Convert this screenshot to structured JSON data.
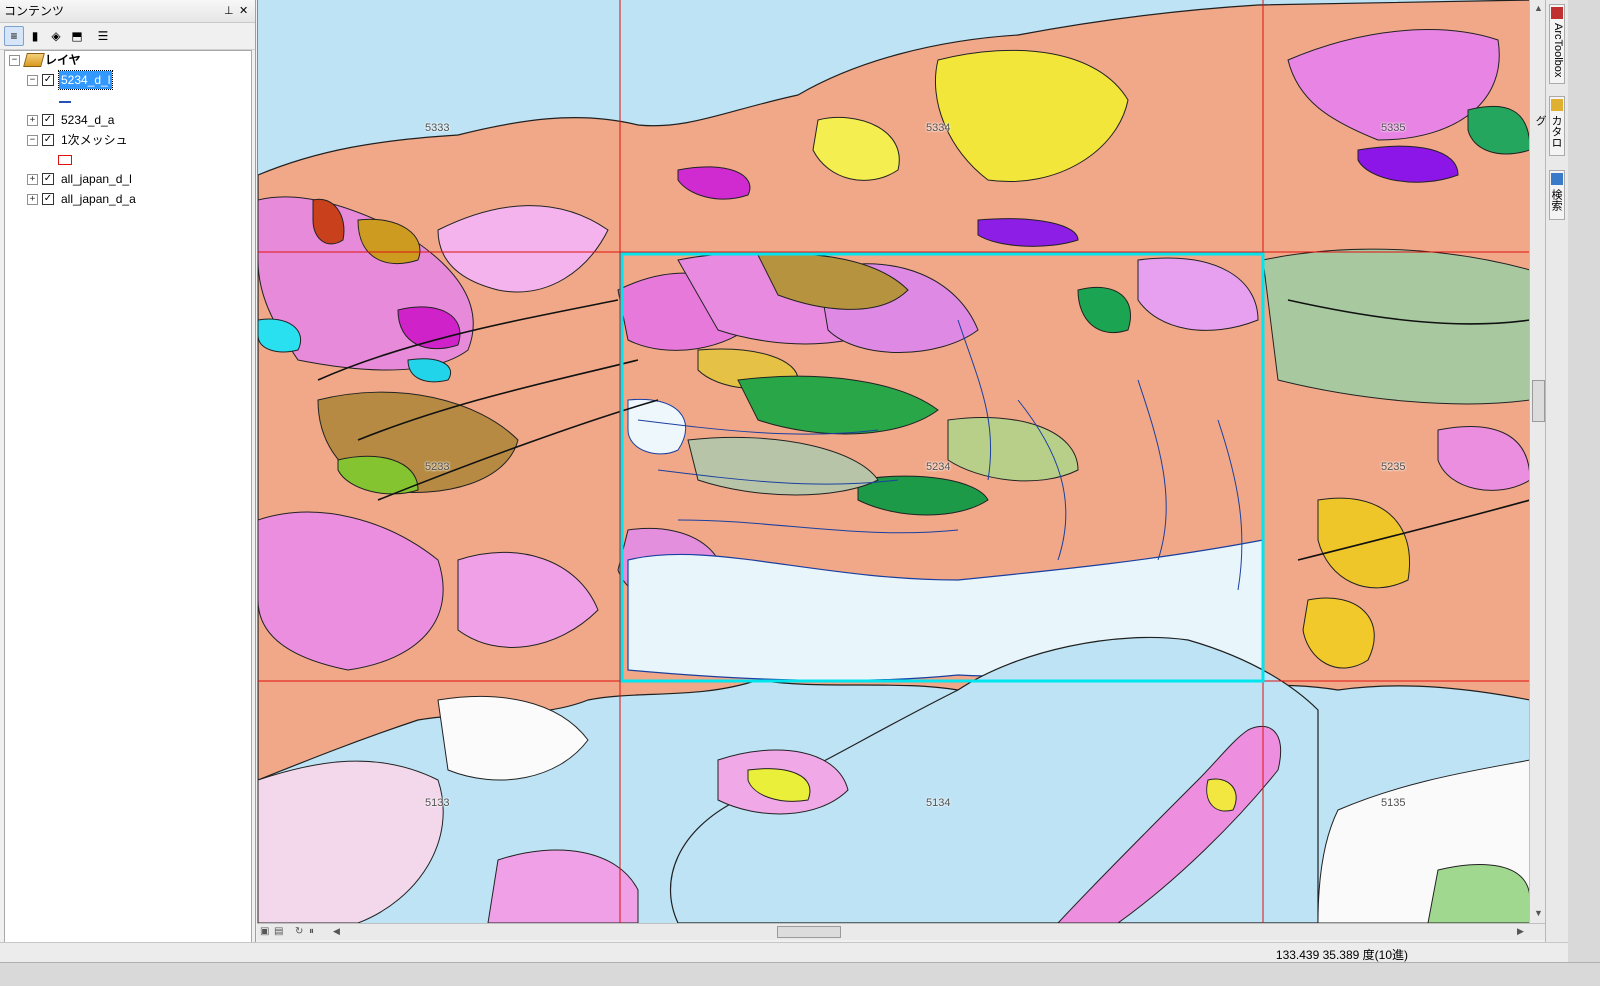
{
  "toc": {
    "title": "コンテンツ",
    "pin_glyph": "ᵖ",
    "close_glyph": "✕",
    "toolbar": [
      {
        "name": "list-by-drawing-order-icon",
        "glyph": "≡",
        "active": true
      },
      {
        "name": "list-by-source-icon",
        "glyph": "▮",
        "active": false
      },
      {
        "name": "list-by-visibility-icon",
        "glyph": "◈",
        "active": false
      },
      {
        "name": "list-by-selection-icon",
        "glyph": "⬒",
        "active": false
      },
      {
        "name": "options-icon",
        "glyph": "☰",
        "active": false
      }
    ],
    "root_label": "レイヤ",
    "layers": [
      {
        "label": "5234_d_l",
        "checked": true,
        "expanded": true,
        "selected": true,
        "symbol": "line"
      },
      {
        "label": "5234_d_a",
        "checked": true,
        "expanded": false,
        "selected": false,
        "symbol": null
      },
      {
        "label": "1次メッシュ",
        "checked": true,
        "expanded": true,
        "selected": false,
        "symbol": "rect"
      },
      {
        "label": "all_japan_d_l",
        "checked": true,
        "expanded": false,
        "selected": false,
        "symbol": null
      },
      {
        "label": "all_japan_d_a",
        "checked": true,
        "expanded": false,
        "selected": false,
        "symbol": null
      }
    ]
  },
  "map": {
    "water_color": "#bde3f5",
    "mesh_line_color": "#e01010",
    "highlight_color": "#00e5ee",
    "mesh_labels": [
      {
        "text": "5333"
      },
      {
        "text": "5334"
      },
      {
        "text": "5335"
      },
      {
        "text": "5233"
      },
      {
        "text": "5234"
      },
      {
        "text": "5235"
      },
      {
        "text": "5133"
      },
      {
        "text": "5134"
      },
      {
        "text": "5135"
      }
    ]
  },
  "dock": {
    "tabs": [
      "ArcToolbox",
      "カタログ",
      "検索"
    ]
  },
  "status": {
    "coordinates": "133.439  35.389 度(10進)"
  }
}
